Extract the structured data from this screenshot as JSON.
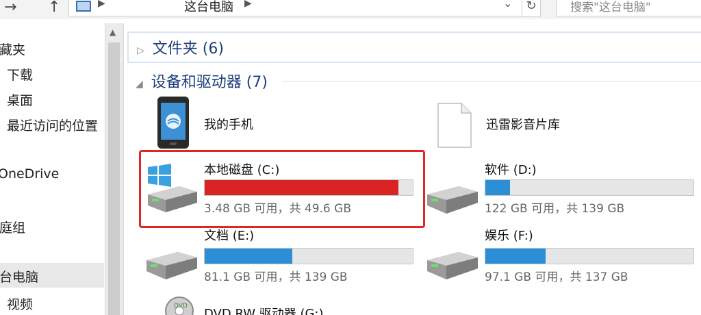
{
  "address_bar": {
    "location": "这台电脑",
    "search_placeholder": "搜索\"这台电脑\""
  },
  "sidebar": {
    "items": [
      {
        "label": "收藏夹"
      },
      {
        "label": "下载"
      },
      {
        "label": "桌面"
      },
      {
        "label": "最近访问的位置"
      },
      {
        "label": "OneDrive"
      },
      {
        "label": "家庭组"
      },
      {
        "label": "这台电脑",
        "selected": true
      },
      {
        "label": "视频"
      }
    ]
  },
  "groups": {
    "folders": {
      "label": "文件夹 (6)",
      "expanded": false
    },
    "devices": {
      "label": "设备和驱动器 (7)",
      "expanded": true
    }
  },
  "devices": [
    {
      "name": "我的手机",
      "type": "phone"
    },
    {
      "name": "迅雷影音片库",
      "type": "file"
    }
  ],
  "drives": [
    {
      "name": "本地磁盘 (C:)",
      "usage": "3.48 GB 可用，共 49.6 GB",
      "used_fraction": 0.93,
      "color": "#da2424",
      "highlighted": true,
      "windows_logo": true
    },
    {
      "name": "软件 (D:)",
      "usage": "122 GB 可用，共 139 GB",
      "used_fraction": 0.12,
      "color": "#2b8fd8"
    },
    {
      "name": "文档 (E:)",
      "usage": "81.1 GB 可用，共 139 GB",
      "used_fraction": 0.42,
      "color": "#2b8fd8"
    },
    {
      "name": "娱乐 (F:)",
      "usage": "97.1 GB 可用，共 137 GB",
      "used_fraction": 0.29,
      "color": "#2b8fd8"
    },
    {
      "name": "DVD RW 驱动器 (G:)",
      "type": "dvd"
    }
  ],
  "colors": {
    "highlight_border": "#e02525",
    "header_text": "#1e3f7a",
    "bar_full": "#da2424",
    "bar_normal": "#2b8fd8"
  }
}
